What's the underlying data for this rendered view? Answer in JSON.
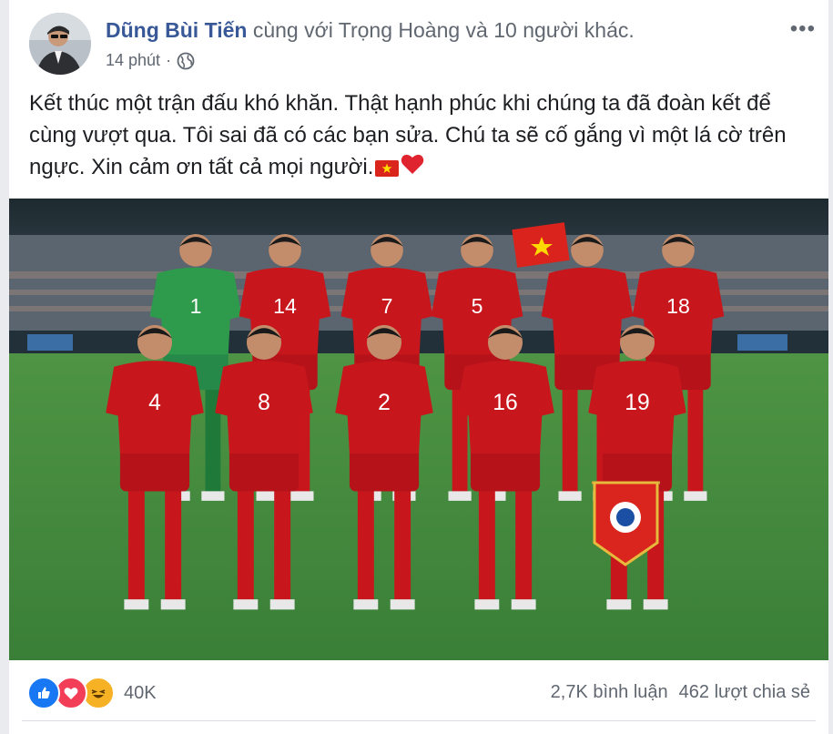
{
  "post": {
    "author": "Dũng Bùi Tiến",
    "with_text": "cùng với Trọng Hoàng và 10 người khác.",
    "time": "14 phút",
    "privacy_icon": "globe-icon",
    "more_label": "•••",
    "text": "Kết thúc một trận đấu khó khăn. Thật hạnh phúc khi chúng ta đã đoàn kết để cùng vượt qua. Tôi sai đã có các bạn sửa. Chú ta sẽ cố gắng vì một lá cờ trên ngực. Xin cảm ơn tất cả mọi người.",
    "emojis": [
      "vietnam-flag-emoji",
      "red-heart-emoji"
    ]
  },
  "photo": {
    "jersey_numbers_back": [
      "1",
      "14",
      "7",
      "5",
      "",
      "18"
    ],
    "jersey_numbers_front": [
      "4",
      "8",
      "2",
      "16",
      "19"
    ],
    "colors": {
      "kit_red": "#c8161d",
      "keeper_green": "#2e9a4b",
      "pitch_green": "#3f8a3a"
    }
  },
  "footer": {
    "reaction_icons": [
      "like-icon",
      "love-icon",
      "haha-icon"
    ],
    "reaction_count": "40K",
    "comments": "2,7K bình luận",
    "shares": "462 lượt chia sẻ"
  },
  "colors": {
    "author_link": "#385898",
    "secondary_text": "#606770",
    "like_blue": "#1877f2",
    "love_red": "#f33e58",
    "haha_yellow": "#f7b125"
  }
}
